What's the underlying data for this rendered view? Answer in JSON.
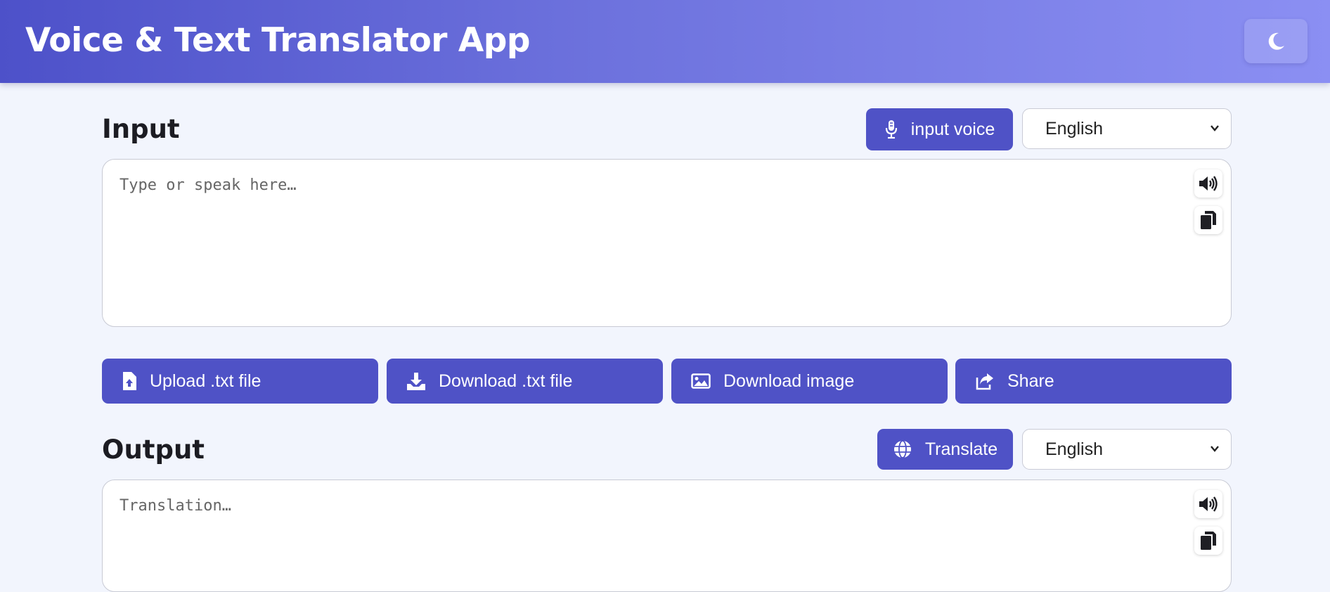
{
  "app": {
    "title": "Voice & Text Translator App"
  },
  "input": {
    "title": "Input",
    "voice_button": "input voice",
    "language": "English",
    "placeholder": "Type or speak here…"
  },
  "actions": {
    "upload": "Upload .txt file",
    "download_txt": "Download .txt file",
    "download_image": "Download image",
    "share": "Share"
  },
  "output": {
    "title": "Output",
    "translate_button": "Translate",
    "language": "English",
    "placeholder": "Translation…"
  },
  "icons": {
    "theme": "moon-icon",
    "voice": "microphone-icon",
    "speak": "speaker-icon",
    "copy": "copy-icon",
    "upload": "file-upload-icon",
    "download": "download-icon",
    "image": "image-icon",
    "share": "share-icon",
    "translate": "globe-icon"
  },
  "colors": {
    "accent": "#4f52c6",
    "header_start": "#4d51c9",
    "header_end": "#8b8ff3",
    "background": "#f2f5fd"
  }
}
